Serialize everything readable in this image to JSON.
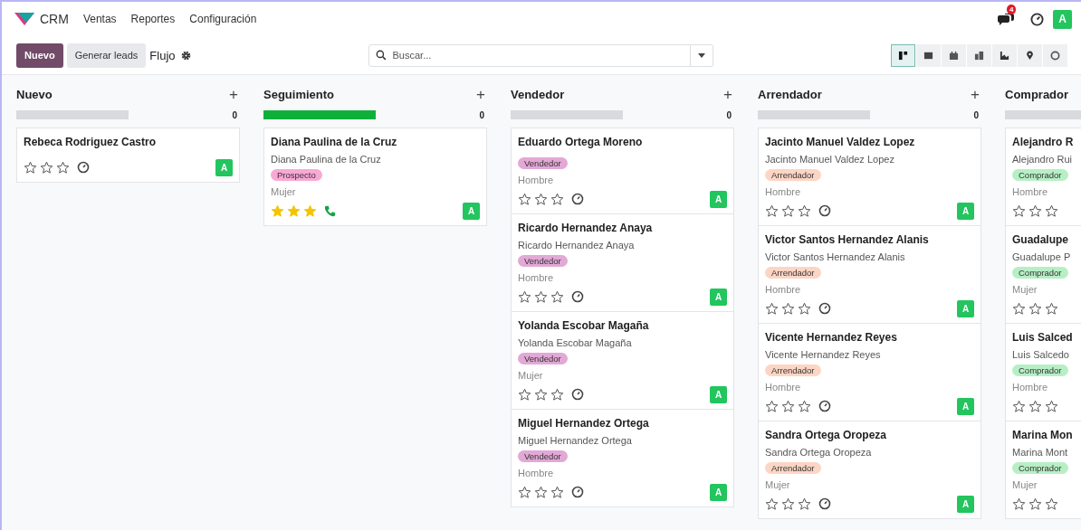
{
  "navbar": {
    "app": "CRM",
    "menu": [
      "Ventas",
      "Reportes",
      "Configuración"
    ],
    "messages_badge": "4",
    "avatar": "A"
  },
  "control_panel": {
    "new_button": "Nuevo",
    "generate_button": "Generar leads",
    "breadcrumb": "Flujo",
    "search": {
      "placeholder": "Buscar..."
    },
    "views": [
      {
        "kind": "kanban",
        "selected": true
      },
      {
        "kind": "list",
        "selected": false
      },
      {
        "kind": "calendar",
        "selected": false
      },
      {
        "kind": "pivot",
        "selected": false
      },
      {
        "kind": "graph",
        "selected": false
      },
      {
        "kind": "map",
        "selected": false
      },
      {
        "kind": "activity",
        "selected": false
      }
    ]
  },
  "columns": [
    {
      "title": "Nuevo",
      "add": "+",
      "count": "0",
      "color": "#d8dadd",
      "cards": [
        {
          "name": "Rebeca Rodriguez Castro",
          "stars": 0,
          "kind": "clock",
          "avatar": "A"
        }
      ]
    },
    {
      "title": "Seguimiento",
      "add": "+",
      "count": "0",
      "color": "#0fb03a",
      "cards": [
        {
          "name": "Diana Paulina de la Cruz",
          "contact": "Diana Paulina de la Cruz",
          "tag": "Prospecto",
          "color": "#f9a8d4",
          "gender": "Mujer",
          "stars": 3,
          "kind": "phone",
          "avatar": "A"
        }
      ]
    },
    {
      "title": "Vendedor",
      "add": "+",
      "count": "0",
      "color": "#d8dadd",
      "cards": [
        {
          "name": "Eduardo Ortega Moreno",
          "tag": "Vendedor",
          "color": "#e2a8d6",
          "gender": "Hombre",
          "stars": 0,
          "kind": "clock",
          "avatar": "A"
        },
        {
          "name": "Ricardo Hernandez Anaya",
          "contact": "Ricardo Hernandez Anaya",
          "tag": "Vendedor",
          "color": "#e2a8d6",
          "gender": "Hombre",
          "stars": 0,
          "kind": "clock",
          "avatar": "A"
        },
        {
          "name": "Yolanda Escobar Magaña",
          "contact": "Yolanda Escobar Magaña",
          "tag": "Vendedor",
          "color": "#e2a8d6",
          "gender": "Mujer",
          "stars": 0,
          "kind": "clock",
          "avatar": "A"
        },
        {
          "name": "Miguel Hernandez Ortega",
          "contact": "Miguel Hernandez Ortega",
          "tag": "Vendedor",
          "color": "#e2a8d6",
          "gender": "Hombre",
          "stars": 0,
          "kind": "clock",
          "avatar": "A"
        }
      ]
    },
    {
      "title": "Arrendador",
      "add": "+",
      "count": "0",
      "color": "#d8dadd",
      "cards": [
        {
          "name": "Jacinto Manuel Valdez Lopez",
          "contact": "Jacinto Manuel Valdez Lopez",
          "tag": "Arrendador",
          "color": "#fdd5c4",
          "gender": "Hombre",
          "stars": 0,
          "kind": "clock",
          "avatar": "A"
        },
        {
          "name": "Victor Santos Hernandez Alanis",
          "contact": "Victor Santos Hernandez Alanis",
          "tag": "Arrendador",
          "color": "#fdd5c4",
          "gender": "Hombre",
          "stars": 0,
          "kind": "clock",
          "avatar": "A"
        },
        {
          "name": "Vicente Hernandez Reyes",
          "contact": "Vicente Hernandez Reyes",
          "tag": "Arrendador",
          "color": "#fdd5c4",
          "gender": "Hombre",
          "stars": 0,
          "kind": "clock",
          "avatar": "A"
        },
        {
          "name": "Sandra Ortega Oropeza",
          "contact": "Sandra Ortega Oropeza",
          "tag": "Arrendador",
          "color": "#fdd5c4",
          "gender": "Mujer",
          "stars": 0,
          "kind": "clock",
          "avatar": "A"
        }
      ]
    },
    {
      "title": "Comprador",
      "color": "#d8dadd",
      "cards": [
        {
          "name": "Alejandro R",
          "contact": "Alejandro Rui",
          "tag": "Comprador",
          "color": "#b7efc5",
          "gender": "Hombre",
          "stars": 0
        },
        {
          "name": "Guadalupe",
          "contact": "Guadalupe P",
          "tag": "Comprador",
          "color": "#b7efc5",
          "gender": "Mujer",
          "stars": 0
        },
        {
          "name": "Luis Salced",
          "contact": "Luis Salcedo",
          "tag": "Comprador",
          "color": "#b7efc5",
          "gender": "Hombre",
          "stars": 0
        },
        {
          "name": "Marina Mon",
          "contact": "Marina Mont",
          "tag": "Comprador",
          "color": "#b7efc5",
          "gender": "Mujer",
          "stars": 0
        }
      ]
    }
  ]
}
